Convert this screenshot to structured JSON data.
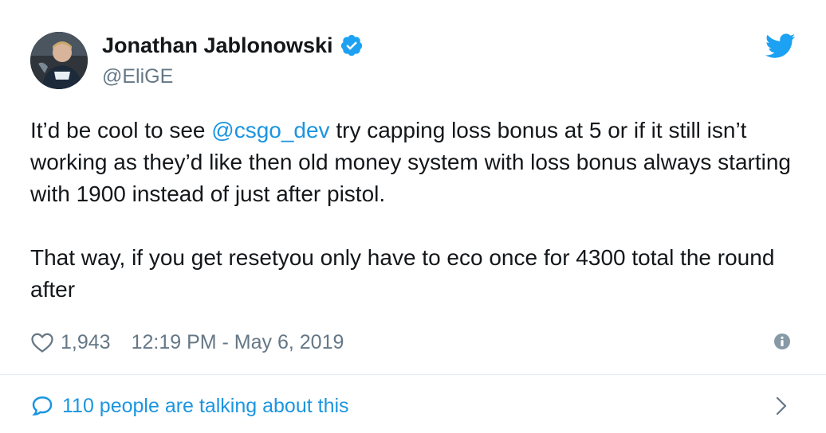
{
  "author": {
    "display_name": "Jonathan Jablonowski",
    "handle": "@EliGE",
    "verified": true
  },
  "tweet": {
    "paragraph1": {
      "before": "It’d be cool to see ",
      "mention": "@csgo_dev",
      "after": " try capping loss bonus at 5 or if it still isn’t working as they’d like then old money system with loss bonus always starting with 1900 instead of just after pistol."
    },
    "paragraph2": "That way, if you get resetyou only have to eco once for 4300 total the round after"
  },
  "meta": {
    "likes": "1,943",
    "timestamp": "12:19 PM - May 6, 2019"
  },
  "footer": {
    "talking_label": "110 people are talking about this"
  },
  "icons": {
    "verified": "verified-badge-icon",
    "brand": "twitter-bird-icon",
    "like": "heart-icon",
    "info": "info-icon",
    "reply": "speech-bubble-icon",
    "more": "chevron-right-icon"
  },
  "colors": {
    "brand_blue": "#1da1f2",
    "link_blue": "#1b95e0",
    "text": "#14171a",
    "secondary_text": "#657786",
    "divider": "#e6ecf0"
  }
}
